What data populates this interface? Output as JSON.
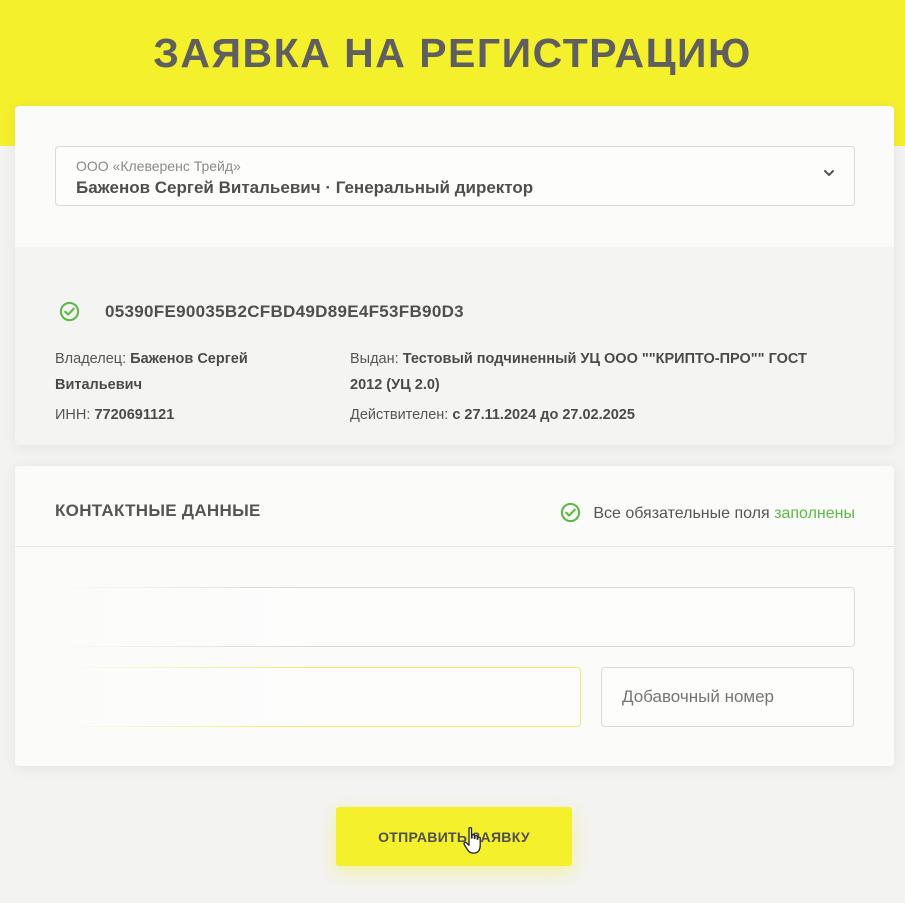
{
  "page": {
    "title": "ЗАЯВКА НА РЕГИСТРАЦИЮ"
  },
  "selector": {
    "org": "ООО «Клеверенс Трейд»",
    "person": "Баженов Сергей Витальевич · Генеральный директор",
    "icon": "chevron-down-icon"
  },
  "certificate": {
    "id": "05390FE90035B2CFBD49D89E4F53FB90D3",
    "owner_label": "Владелец:",
    "owner_value_line1": "Баженов Сергей",
    "owner_value_line2": "Витальевич",
    "inn_label": "ИНН:",
    "inn_value": "7720691121",
    "issued_label": "Выдан:",
    "issued_value_line1": "Тестовый подчиненный УЦ ООО \"\"КРИПТО-ПРО\"\" ГОСТ",
    "issued_value_line2": "2012 (УЦ 2.0)",
    "valid_label": "Действителен:",
    "valid_value": "с 27.11.2024 до 27.02.2025"
  },
  "contacts": {
    "title": "КОНТАКТНЫЕ ДАННЫЕ",
    "status_text": "Все обязательные поля",
    "status_ok": "заполнены",
    "extension_placeholder": "Добавочный номер"
  },
  "submit": {
    "label": "ОТПРАВИТЬ ЗАЯВКУ"
  },
  "colors": {
    "accent": "#f5f02c",
    "success": "#5bbb44",
    "text": "#4f4f4f"
  }
}
